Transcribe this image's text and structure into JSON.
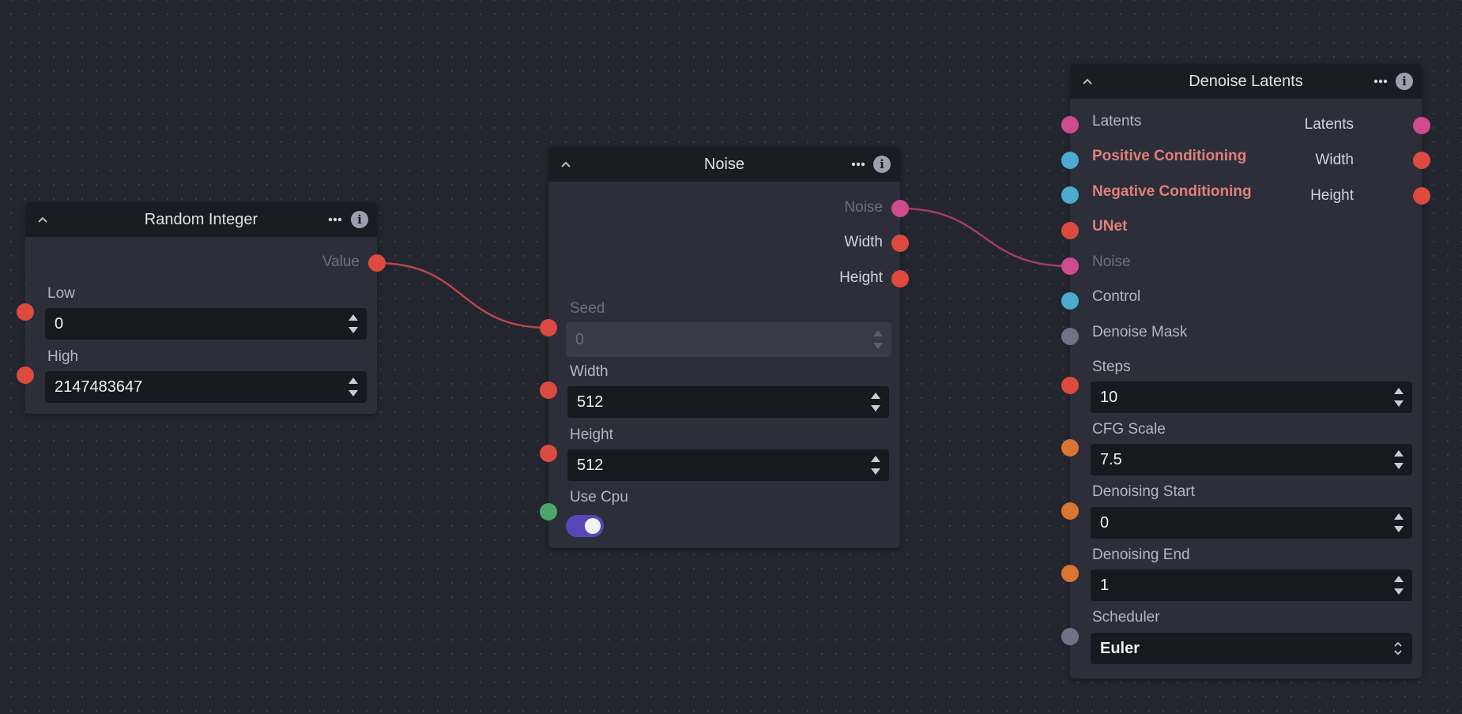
{
  "colors": {
    "canvas": "#24262f",
    "node_body": "#2c2f3a",
    "node_header": "#1b1c22",
    "field_bg": "#18191e",
    "edge": "#b5474f",
    "edge_pink": "#a0405f",
    "toggle_on": "#5946b8",
    "handle_red": "#dc4a40",
    "handle_pink": "#d04b90",
    "handle_blue": "#4cacd0",
    "handle_gray": "#6e7385",
    "handle_orange": "#dc7531",
    "handle_green": "#4fa66c"
  },
  "random_integer": {
    "title": "Random Integer",
    "collapse_icon": "chevron-up-icon",
    "menu_icon": "ellipsis-icon",
    "info_icon": "info-icon",
    "info_glyph": "i",
    "output_value": "Value",
    "low_label": "Low",
    "low_value": "0",
    "high_label": "High",
    "high_value": "2147483647"
  },
  "noise": {
    "title": "Noise",
    "info_glyph": "i",
    "out_noise": "Noise",
    "out_width": "Width",
    "out_height": "Height",
    "seed_label": "Seed",
    "seed_value": "0",
    "width_label": "Width",
    "width_value": "512",
    "height_label": "Height",
    "height_value": "512",
    "use_cpu_label": "Use Cpu",
    "use_cpu_enabled": true
  },
  "denoise": {
    "title": "Denoise Latents",
    "info_glyph": "i",
    "in_latents": "Latents",
    "in_positive": "Positive Conditioning",
    "in_negative": "Negative Conditioning",
    "in_unet": "UNet",
    "in_noise": "Noise",
    "in_control": "Control",
    "in_mask": "Denoise Mask",
    "out_latents": "Latents",
    "out_width": "Width",
    "out_height": "Height",
    "steps_label": "Steps",
    "steps_value": "10",
    "cfg_label": "CFG Scale",
    "cfg_value": "7.5",
    "start_label": "Denoising Start",
    "start_value": "0",
    "end_label": "Denoising End",
    "end_value": "1",
    "scheduler_label": "Scheduler",
    "scheduler_value": "Euler"
  }
}
